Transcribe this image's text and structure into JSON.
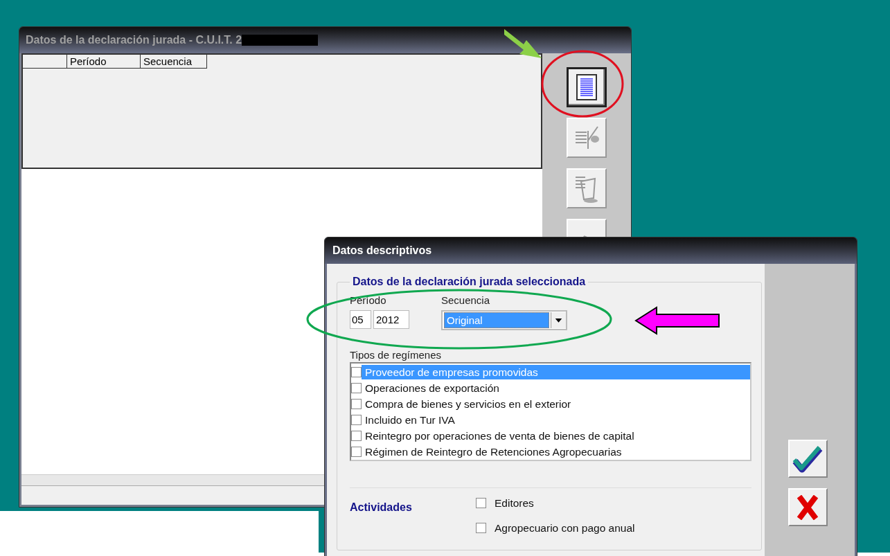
{
  "main_window": {
    "title": "Datos de la declaración jurada - C.U.I.T. 2",
    "table": {
      "columns": [
        "Período",
        "Secuencia"
      ]
    },
    "toolbar": [
      {
        "kind": "document",
        "selected": true
      },
      {
        "kind": "edit",
        "selected": false
      },
      {
        "kind": "delete",
        "selected": false
      },
      {
        "kind": "other",
        "selected": false
      }
    ]
  },
  "dialog": {
    "title": "Datos descriptivos",
    "group_title": "Datos de la declaración jurada seleccionada",
    "period": {
      "label": "Período",
      "month": "05",
      "year": "2012"
    },
    "sequence": {
      "label": "Secuencia",
      "value": "Original"
    },
    "regimes": {
      "label": "Tipos de regímenes",
      "items": [
        {
          "label": "Proveedor de empresas promovidas",
          "checked": false,
          "selected": true
        },
        {
          "label": "Operaciones de exportación",
          "checked": false,
          "selected": false
        },
        {
          "label": "Compra de bienes y servicios en el exterior",
          "checked": false,
          "selected": false
        },
        {
          "label": "Incluido en Tur IVA",
          "checked": false,
          "selected": false
        },
        {
          "label": "Reintegro por operaciones de venta de bienes de capital",
          "checked": false,
          "selected": false
        },
        {
          "label": "Régimen de Reintegro de Retenciones Agropecuarias",
          "checked": false,
          "selected": false
        }
      ]
    },
    "activities": {
      "label": "Actividades",
      "items": [
        {
          "label": "Editores",
          "checked": false
        },
        {
          "label": "Agropecuario con pago anual",
          "checked": false
        }
      ]
    },
    "buttons": [
      {
        "kind": "accept"
      },
      {
        "kind": "cancel"
      }
    ]
  }
}
